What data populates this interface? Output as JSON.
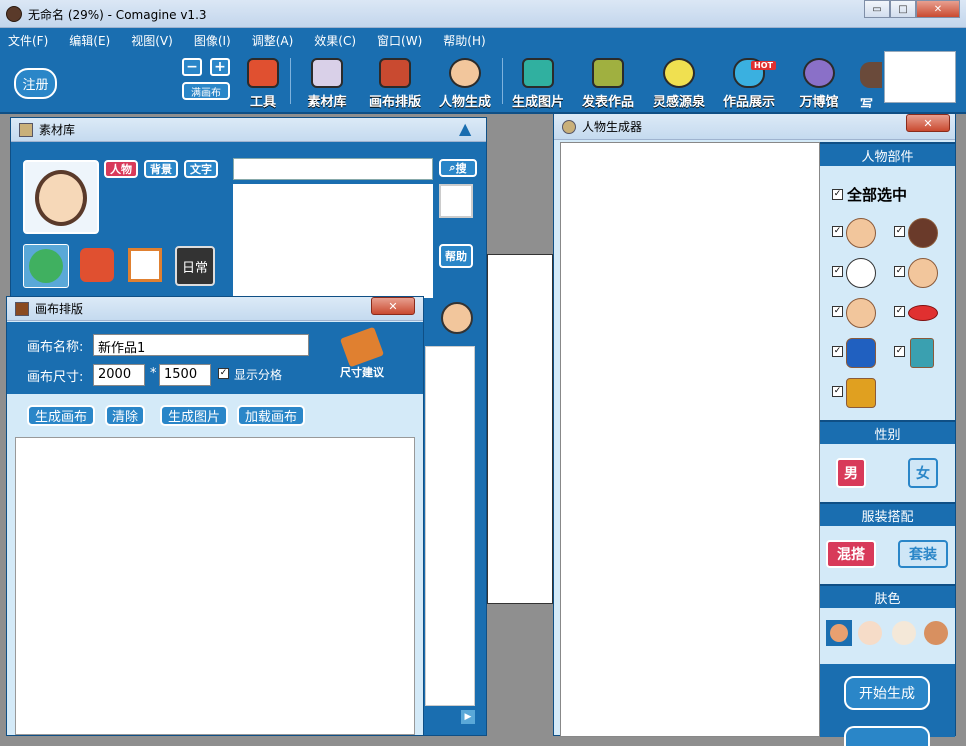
{
  "window": {
    "title": "无命名 (29%) - Comagine v1.3",
    "min": "▭",
    "max": "□",
    "close": "✕"
  },
  "menu": [
    "文件(F)",
    "编辑(E)",
    "视图(V)",
    "图像(I)",
    "调整(A)",
    "效果(C)",
    "窗口(W)",
    "帮助(H)"
  ],
  "toolbar": {
    "register": "注册",
    "zoom_out": "−",
    "zoom_in": "+",
    "fill_canvas": "满画布",
    "tools": [
      "工具",
      "素材库",
      "画布排版",
      "人物生成",
      "生成图片",
      "发表作品",
      "灵感源泉",
      "作品展示",
      "万博馆",
      "写"
    ],
    "hot_badge": "HOT"
  },
  "material": {
    "title": "素材库",
    "tags": [
      "人物",
      "背景",
      "文字"
    ],
    "search_value": "",
    "search_btn": "搜",
    "daily": "日常",
    "help": "帮助"
  },
  "canvas_panel": {
    "title": "画布排版",
    "name_label": "画布名称:",
    "name_value": "新作品1",
    "size_label": "画布尺寸:",
    "width": "2000",
    "times": "*",
    "height": "1500",
    "show_grid": "显示分格",
    "size_suggest": "尺寸建议",
    "buttons": [
      "生成画布",
      "清除",
      "生成图片",
      "加载画布"
    ]
  },
  "char_panel": {
    "title": "人物生成器",
    "parts_header": "人物部件",
    "select_all": "全部选中",
    "gender_header": "性别",
    "male": "男",
    "female": "女",
    "outfit_header": "服装搭配",
    "mix": "混搭",
    "set": "套装",
    "skin_header": "肤色",
    "skin_colors": [
      "#e8a070",
      "#f6dcc8",
      "#f4e8d8",
      "#d89060"
    ],
    "start": "开始生成",
    "check": "✓"
  }
}
